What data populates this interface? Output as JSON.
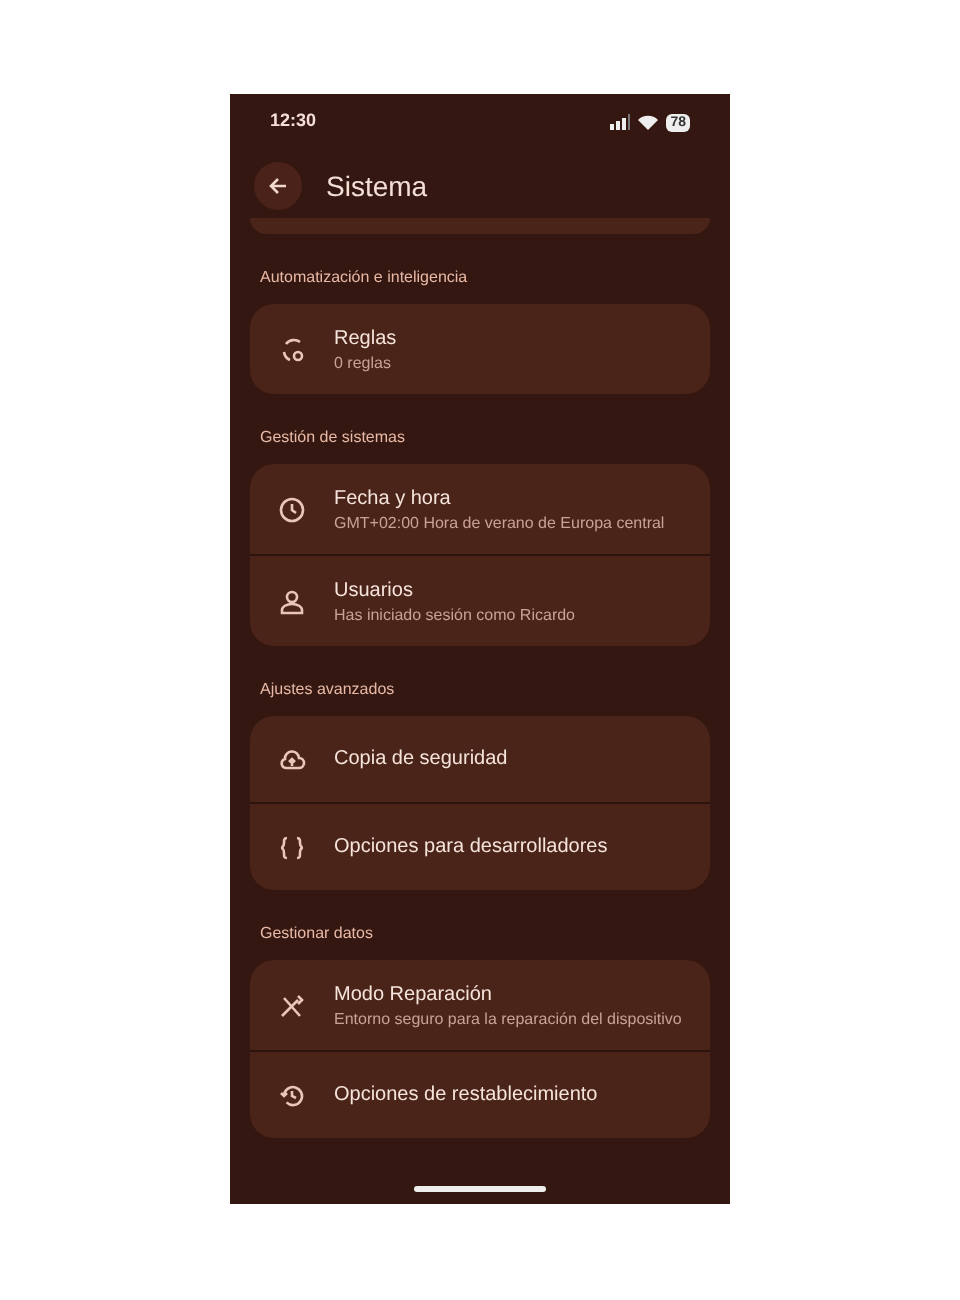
{
  "status_bar": {
    "time": "12:30",
    "battery": "78"
  },
  "header": {
    "title": "Sistema"
  },
  "sections": [
    {
      "title": "Automatización e inteligencia",
      "items": [
        {
          "title": "Reglas",
          "subtitle": "0 reglas"
        }
      ]
    },
    {
      "title": "Gestión de sistemas",
      "items": [
        {
          "title": "Fecha y hora",
          "subtitle": "GMT+02:00 Hora de verano de Europa central"
        },
        {
          "title": "Usuarios",
          "subtitle": "Has iniciado sesión como Ricardo"
        }
      ]
    },
    {
      "title": "Ajustes avanzados",
      "items": [
        {
          "title": "Copia de seguridad"
        },
        {
          "title": "Opciones para desarrolladores"
        }
      ]
    },
    {
      "title": "Gestionar datos",
      "items": [
        {
          "title": "Modo Reparación",
          "subtitle": "Entorno seguro para la reparación del dispositivo"
        },
        {
          "title": "Opciones de restablecimiento"
        }
      ]
    }
  ]
}
